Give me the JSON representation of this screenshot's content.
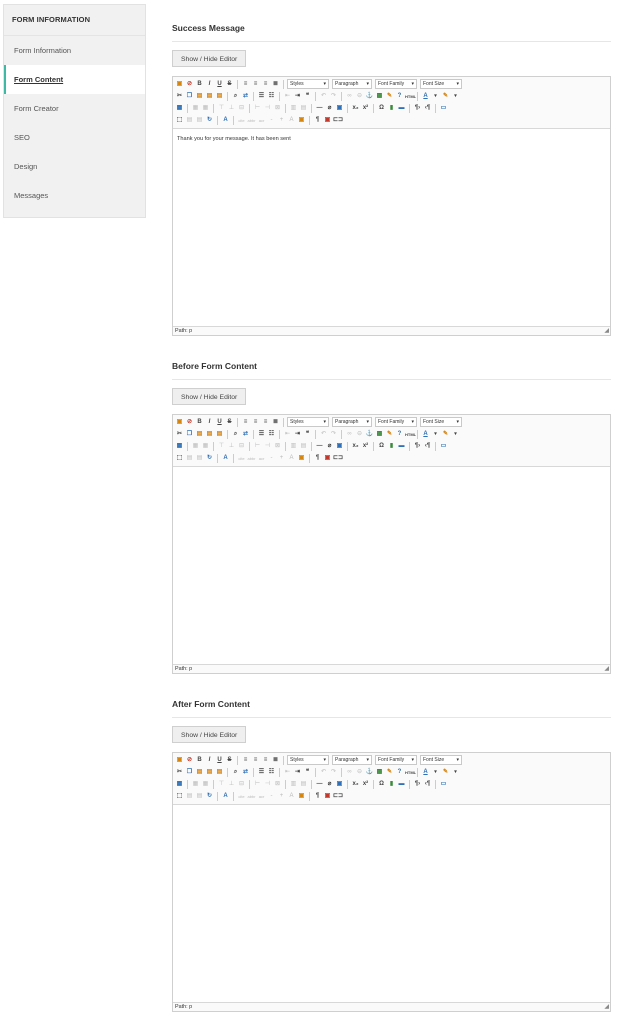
{
  "sidebar": {
    "header": "FORM INFORMATION",
    "items": [
      {
        "label": "Form Information",
        "active": false
      },
      {
        "label": "Form Content",
        "active": true
      },
      {
        "label": "Form Creator",
        "active": false
      },
      {
        "label": "SEO",
        "active": false
      },
      {
        "label": "Design",
        "active": false
      },
      {
        "label": "Messages",
        "active": false
      }
    ]
  },
  "toolbar": {
    "styles": "Styles",
    "format": "Paragraph",
    "font_family": "Font Family",
    "font_size": "Font Size"
  },
  "sections": [
    {
      "title": "Success Message",
      "button": "Show / Hide Editor",
      "content": "Thank you for your message. It has been sent",
      "path": "Path: p"
    },
    {
      "title": "Before Form Content",
      "button": "Show / Hide Editor",
      "content": "",
      "path": "Path: p"
    },
    {
      "title": "After Form Content",
      "button": "Show / Hide Editor",
      "content": "",
      "path": "Path: p"
    }
  ],
  "colors": {
    "accent": "#3fb8a5",
    "sidebar_bg": "#f1f1f1"
  }
}
